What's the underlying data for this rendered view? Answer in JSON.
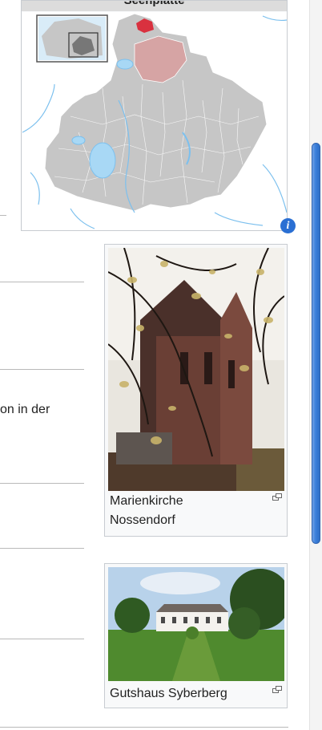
{
  "map_box": {
    "title": "Seenplatte",
    "info_icon": "i"
  },
  "article": {
    "clipped_line": "on in der"
  },
  "thumbnails": [
    {
      "caption_line1": "Marienkirche",
      "caption_line2": "Nossendorf",
      "icon": "enlarge-icon"
    },
    {
      "caption": "Gutshaus Syberberg",
      "icon": "enlarge-icon"
    }
  ]
}
